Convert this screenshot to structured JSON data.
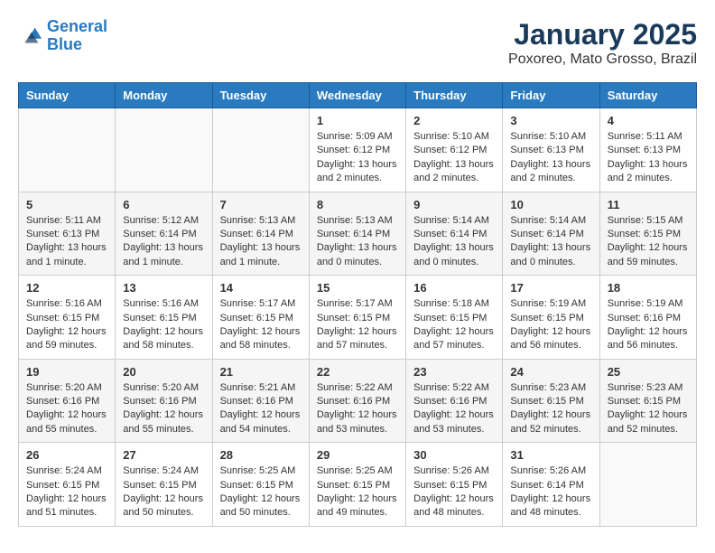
{
  "header": {
    "logo_line1": "General",
    "logo_line2": "Blue",
    "title": "January 2025",
    "subtitle": "Poxoreo, Mato Grosso, Brazil"
  },
  "weekdays": [
    "Sunday",
    "Monday",
    "Tuesday",
    "Wednesday",
    "Thursday",
    "Friday",
    "Saturday"
  ],
  "weeks": [
    [
      {
        "day": "",
        "sunrise": "",
        "sunset": "",
        "daylight": ""
      },
      {
        "day": "",
        "sunrise": "",
        "sunset": "",
        "daylight": ""
      },
      {
        "day": "",
        "sunrise": "",
        "sunset": "",
        "daylight": ""
      },
      {
        "day": "1",
        "sunrise": "Sunrise: 5:09 AM",
        "sunset": "Sunset: 6:12 PM",
        "daylight": "Daylight: 13 hours and 2 minutes."
      },
      {
        "day": "2",
        "sunrise": "Sunrise: 5:10 AM",
        "sunset": "Sunset: 6:12 PM",
        "daylight": "Daylight: 13 hours and 2 minutes."
      },
      {
        "day": "3",
        "sunrise": "Sunrise: 5:10 AM",
        "sunset": "Sunset: 6:13 PM",
        "daylight": "Daylight: 13 hours and 2 minutes."
      },
      {
        "day": "4",
        "sunrise": "Sunrise: 5:11 AM",
        "sunset": "Sunset: 6:13 PM",
        "daylight": "Daylight: 13 hours and 2 minutes."
      }
    ],
    [
      {
        "day": "5",
        "sunrise": "Sunrise: 5:11 AM",
        "sunset": "Sunset: 6:13 PM",
        "daylight": "Daylight: 13 hours and 1 minute."
      },
      {
        "day": "6",
        "sunrise": "Sunrise: 5:12 AM",
        "sunset": "Sunset: 6:14 PM",
        "daylight": "Daylight: 13 hours and 1 minute."
      },
      {
        "day": "7",
        "sunrise": "Sunrise: 5:13 AM",
        "sunset": "Sunset: 6:14 PM",
        "daylight": "Daylight: 13 hours and 1 minute."
      },
      {
        "day": "8",
        "sunrise": "Sunrise: 5:13 AM",
        "sunset": "Sunset: 6:14 PM",
        "daylight": "Daylight: 13 hours and 0 minutes."
      },
      {
        "day": "9",
        "sunrise": "Sunrise: 5:14 AM",
        "sunset": "Sunset: 6:14 PM",
        "daylight": "Daylight: 13 hours and 0 minutes."
      },
      {
        "day": "10",
        "sunrise": "Sunrise: 5:14 AM",
        "sunset": "Sunset: 6:14 PM",
        "daylight": "Daylight: 13 hours and 0 minutes."
      },
      {
        "day": "11",
        "sunrise": "Sunrise: 5:15 AM",
        "sunset": "Sunset: 6:15 PM",
        "daylight": "Daylight: 12 hours and 59 minutes."
      }
    ],
    [
      {
        "day": "12",
        "sunrise": "Sunrise: 5:16 AM",
        "sunset": "Sunset: 6:15 PM",
        "daylight": "Daylight: 12 hours and 59 minutes."
      },
      {
        "day": "13",
        "sunrise": "Sunrise: 5:16 AM",
        "sunset": "Sunset: 6:15 PM",
        "daylight": "Daylight: 12 hours and 58 minutes."
      },
      {
        "day": "14",
        "sunrise": "Sunrise: 5:17 AM",
        "sunset": "Sunset: 6:15 PM",
        "daylight": "Daylight: 12 hours and 58 minutes."
      },
      {
        "day": "15",
        "sunrise": "Sunrise: 5:17 AM",
        "sunset": "Sunset: 6:15 PM",
        "daylight": "Daylight: 12 hours and 57 minutes."
      },
      {
        "day": "16",
        "sunrise": "Sunrise: 5:18 AM",
        "sunset": "Sunset: 6:15 PM",
        "daylight": "Daylight: 12 hours and 57 minutes."
      },
      {
        "day": "17",
        "sunrise": "Sunrise: 5:19 AM",
        "sunset": "Sunset: 6:15 PM",
        "daylight": "Daylight: 12 hours and 56 minutes."
      },
      {
        "day": "18",
        "sunrise": "Sunrise: 5:19 AM",
        "sunset": "Sunset: 6:16 PM",
        "daylight": "Daylight: 12 hours and 56 minutes."
      }
    ],
    [
      {
        "day": "19",
        "sunrise": "Sunrise: 5:20 AM",
        "sunset": "Sunset: 6:16 PM",
        "daylight": "Daylight: 12 hours and 55 minutes."
      },
      {
        "day": "20",
        "sunrise": "Sunrise: 5:20 AM",
        "sunset": "Sunset: 6:16 PM",
        "daylight": "Daylight: 12 hours and 55 minutes."
      },
      {
        "day": "21",
        "sunrise": "Sunrise: 5:21 AM",
        "sunset": "Sunset: 6:16 PM",
        "daylight": "Daylight: 12 hours and 54 minutes."
      },
      {
        "day": "22",
        "sunrise": "Sunrise: 5:22 AM",
        "sunset": "Sunset: 6:16 PM",
        "daylight": "Daylight: 12 hours and 53 minutes."
      },
      {
        "day": "23",
        "sunrise": "Sunrise: 5:22 AM",
        "sunset": "Sunset: 6:16 PM",
        "daylight": "Daylight: 12 hours and 53 minutes."
      },
      {
        "day": "24",
        "sunrise": "Sunrise: 5:23 AM",
        "sunset": "Sunset: 6:15 PM",
        "daylight": "Daylight: 12 hours and 52 minutes."
      },
      {
        "day": "25",
        "sunrise": "Sunrise: 5:23 AM",
        "sunset": "Sunset: 6:15 PM",
        "daylight": "Daylight: 12 hours and 52 minutes."
      }
    ],
    [
      {
        "day": "26",
        "sunrise": "Sunrise: 5:24 AM",
        "sunset": "Sunset: 6:15 PM",
        "daylight": "Daylight: 12 hours and 51 minutes."
      },
      {
        "day": "27",
        "sunrise": "Sunrise: 5:24 AM",
        "sunset": "Sunset: 6:15 PM",
        "daylight": "Daylight: 12 hours and 50 minutes."
      },
      {
        "day": "28",
        "sunrise": "Sunrise: 5:25 AM",
        "sunset": "Sunset: 6:15 PM",
        "daylight": "Daylight: 12 hours and 50 minutes."
      },
      {
        "day": "29",
        "sunrise": "Sunrise: 5:25 AM",
        "sunset": "Sunset: 6:15 PM",
        "daylight": "Daylight: 12 hours and 49 minutes."
      },
      {
        "day": "30",
        "sunrise": "Sunrise: 5:26 AM",
        "sunset": "Sunset: 6:15 PM",
        "daylight": "Daylight: 12 hours and 48 minutes."
      },
      {
        "day": "31",
        "sunrise": "Sunrise: 5:26 AM",
        "sunset": "Sunset: 6:14 PM",
        "daylight": "Daylight: 12 hours and 48 minutes."
      },
      {
        "day": "",
        "sunrise": "",
        "sunset": "",
        "daylight": ""
      }
    ]
  ]
}
